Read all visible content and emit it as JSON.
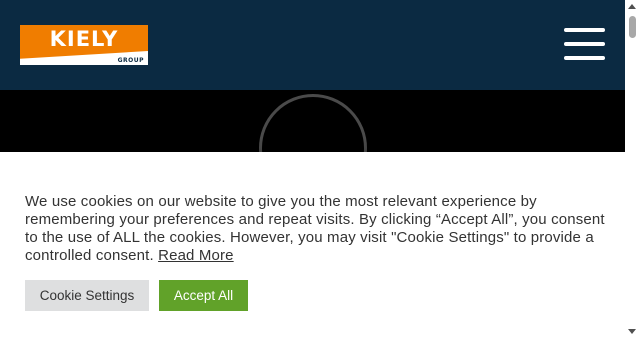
{
  "header": {
    "logo": {
      "name": "KIELY",
      "sub": "GROUP",
      "color": "#f07d00"
    },
    "background": "#0b2a42",
    "menu_icon": "hamburger-menu-icon"
  },
  "hero": {
    "background": "#000000",
    "spinner_icon": "loading-ring-icon"
  },
  "cookie_banner": {
    "message": "We use cookies on our website to give you the most relevant experience by remembering your preferences and repeat visits. By clicking “Accept All”, you consent to the use of ALL the cookies. However, you may visit \"Cookie Settings\" to provide a controlled consent.",
    "read_more": "Read More",
    "settings_label": "Cookie Settings",
    "accept_label": "Accept All",
    "accept_color": "#61a229",
    "settings_color": "#dedfe0"
  }
}
